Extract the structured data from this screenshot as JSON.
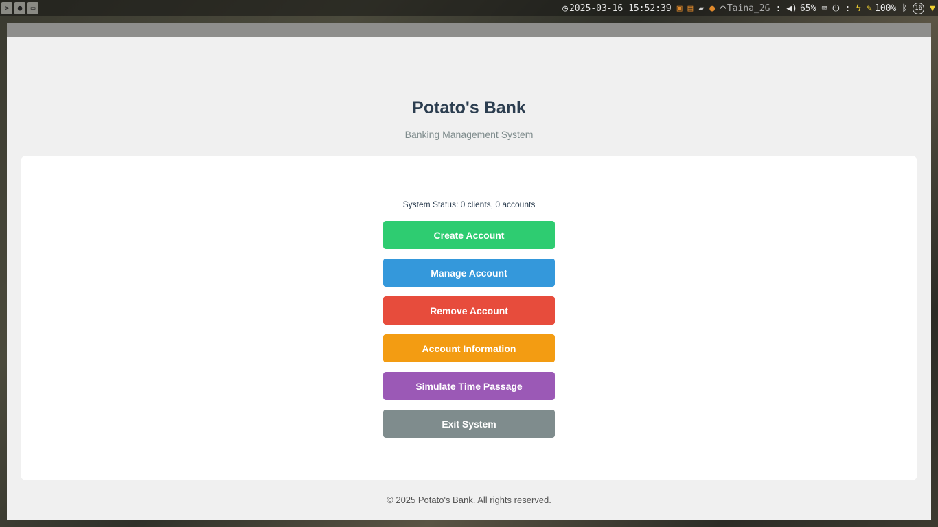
{
  "topbar": {
    "left_icons": [
      "terminal-icon",
      "disk-icon",
      "folder-icon"
    ],
    "datetime": "2025-03-16 15:52:39",
    "wifi_name": "Taina_2G",
    "separator1": ":",
    "volume": "65%",
    "separator2": ":",
    "battery": "100%",
    "notif_count": "16"
  },
  "app": {
    "title": "Potato's Bank",
    "subtitle": "Banking Management System",
    "status": "System Status: 0 clients, 0 accounts",
    "buttons": [
      {
        "label": "Create Account",
        "color": "#2ecc71"
      },
      {
        "label": "Manage Account",
        "color": "#3498db"
      },
      {
        "label": "Remove Account",
        "color": "#e74c3c"
      },
      {
        "label": "Account Information",
        "color": "#f39c12"
      },
      {
        "label": "Simulate Time Passage",
        "color": "#9b59b6"
      },
      {
        "label": "Exit System",
        "color": "#7f8c8d"
      }
    ],
    "footer": "© 2025 Potato's Bank. All rights reserved."
  },
  "colors": {
    "title": "#2c3e50",
    "subtitle": "#7f8c8d",
    "window_bg": "#f0f0f0",
    "card_bg": "#ffffff"
  }
}
